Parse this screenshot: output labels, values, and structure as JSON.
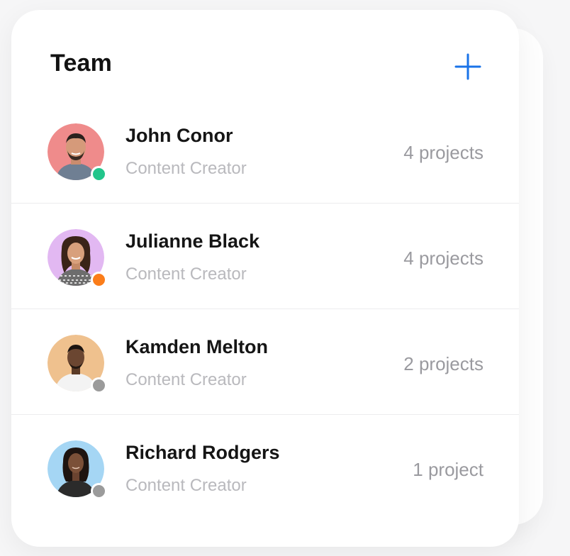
{
  "header": {
    "title": "Team",
    "add_icon": "plus-icon",
    "accent": "#1a73e8"
  },
  "members": [
    {
      "name": "John Conor",
      "role": "Content Creator",
      "projects": "4 projects",
      "avatar_bg": "#ef8b8b",
      "status_color": "#22c58b",
      "icon": "avatar-photo"
    },
    {
      "name": "Julianne Black",
      "role": "Content Creator",
      "projects": "4 projects",
      "avatar_bg": "#e2b8f2",
      "status_color": "#fb7d1a",
      "icon": "avatar-photo"
    },
    {
      "name": "Kamden Melton",
      "role": "Content Creator",
      "projects": "2 projects",
      "avatar_bg": "#efc18e",
      "status_color": "#9b9b9b",
      "icon": "avatar-photo"
    },
    {
      "name": "Richard Rodgers",
      "role": "Content Creator",
      "projects": "1 project",
      "avatar_bg": "#a5d6f4",
      "status_color": "#9b9b9b",
      "icon": "avatar-photo"
    }
  ]
}
